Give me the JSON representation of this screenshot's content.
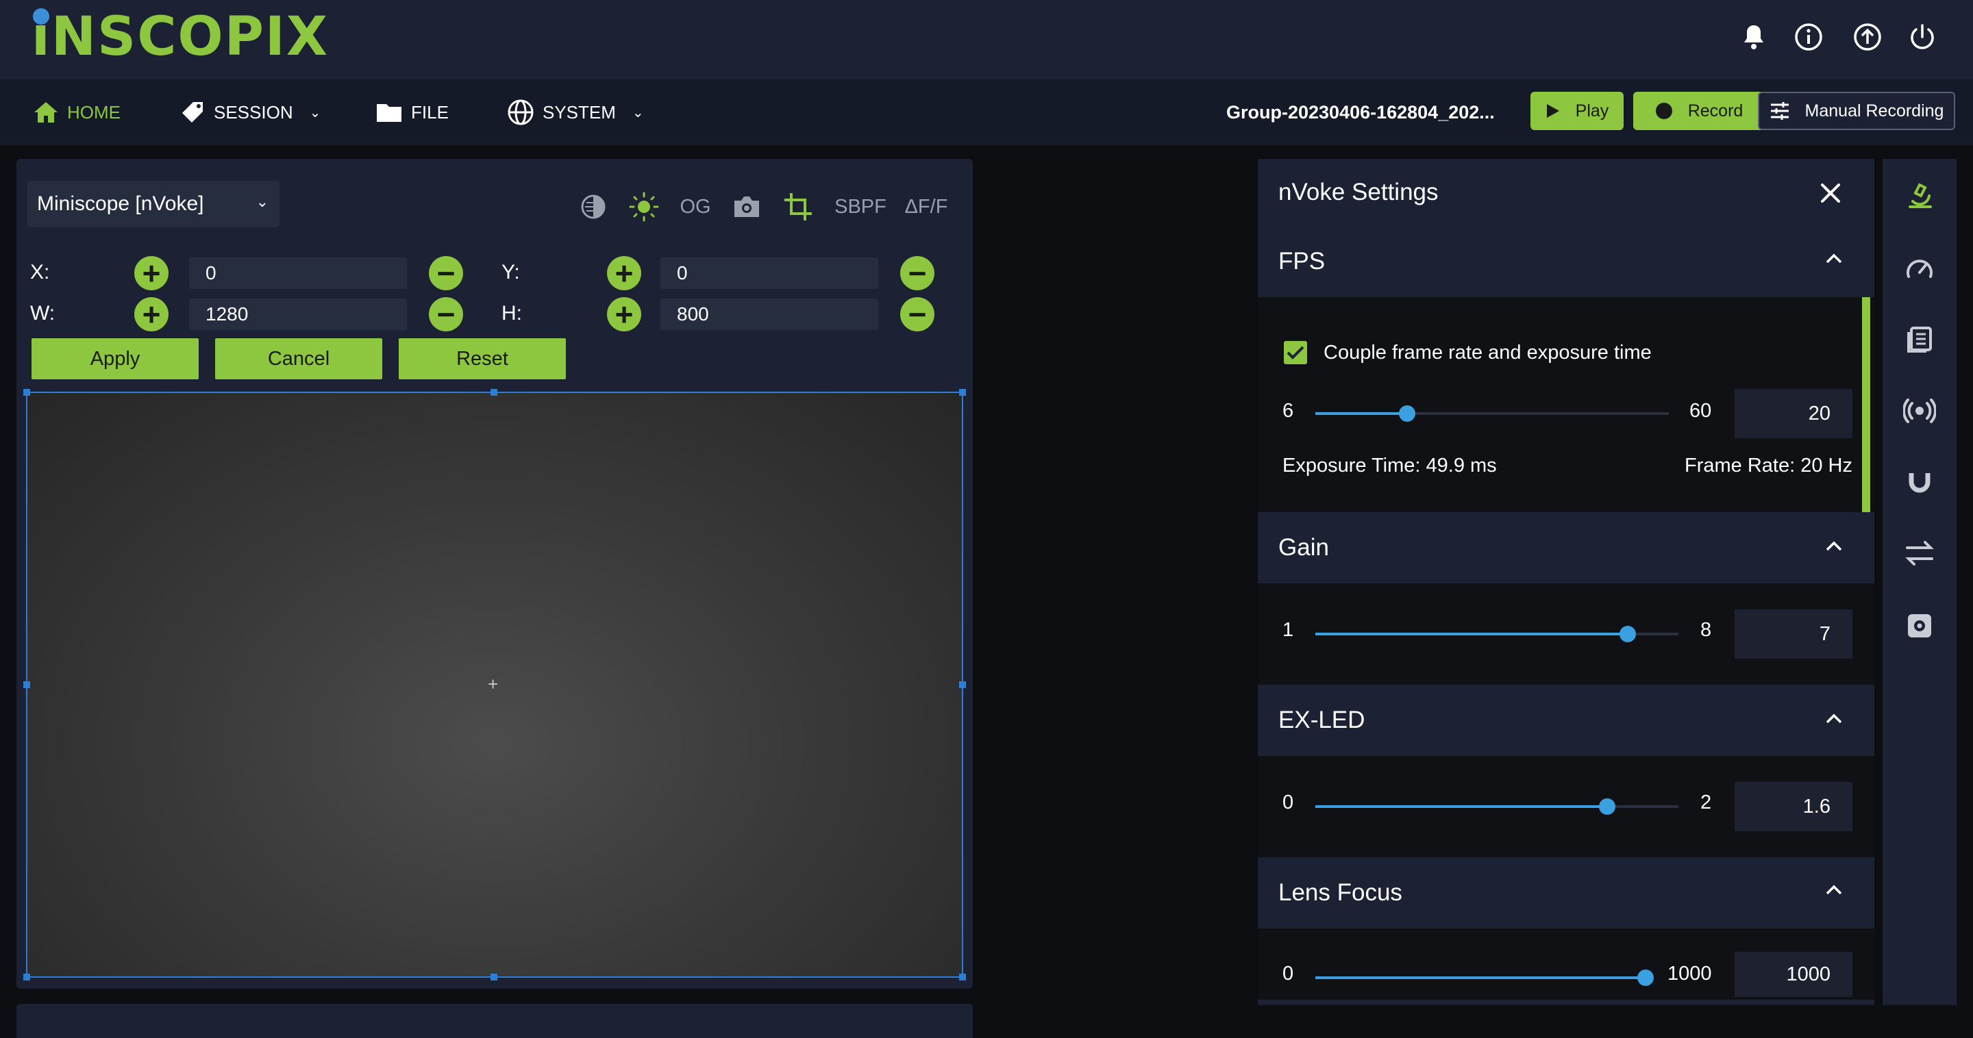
{
  "brand": {
    "logo_text": "iNSCOPIX"
  },
  "top_icons": [
    "bell-icon",
    "info-icon",
    "upload-icon",
    "power-icon"
  ],
  "nav": {
    "home": "HOME",
    "session": "SESSION",
    "file": "FILE",
    "system": "SYSTEM",
    "chevron": "⌄"
  },
  "session_name": "Group-20230406-162804_202...",
  "buttons": {
    "play": "Play",
    "record": "Record",
    "manual_recording": "Manual Recording",
    "apply": "Apply",
    "cancel": "Cancel",
    "reset": "Reset"
  },
  "viewer": {
    "device_select": "Miniscope [nVoke]",
    "tools": {
      "og": "OG",
      "sbpf": "SBPF",
      "dff": "ΔF/F"
    },
    "crop": {
      "x_label": "X:",
      "x_value": "0",
      "y_label": "Y:",
      "y_value": "0",
      "w_label": "W:",
      "w_value": "1280",
      "h_label": "H:",
      "h_value": "800"
    },
    "crosshair": "+"
  },
  "settings": {
    "title": "nVoke Settings",
    "fps": {
      "title": "FPS",
      "couple_label": "Couple frame rate and exposure time",
      "couple_checked": true,
      "min": "6",
      "max": "60",
      "value": "20",
      "exposure_text": "Exposure Time: 49.9 ms",
      "frame_rate_text": "Frame Rate: 20 Hz"
    },
    "gain": {
      "title": "Gain",
      "min": "1",
      "max": "8",
      "value": "7"
    },
    "ex_led": {
      "title": "EX-LED",
      "min": "0",
      "max": "2",
      "value": "1.6"
    },
    "lens_focus": {
      "title": "Lens Focus",
      "min": "0",
      "max": "1000",
      "value": "1000"
    }
  },
  "rail_icons": [
    "microscope-icon",
    "gauge-icon",
    "book-icon",
    "broadcast-icon",
    "magnet-icon",
    "swap-arrows-icon",
    "settings-gear-icon"
  ],
  "colors": {
    "accent": "#8dc63f",
    "slider": "#3ba0e0",
    "panel": "#1c2233",
    "frame_border": "#2d7fd6"
  }
}
